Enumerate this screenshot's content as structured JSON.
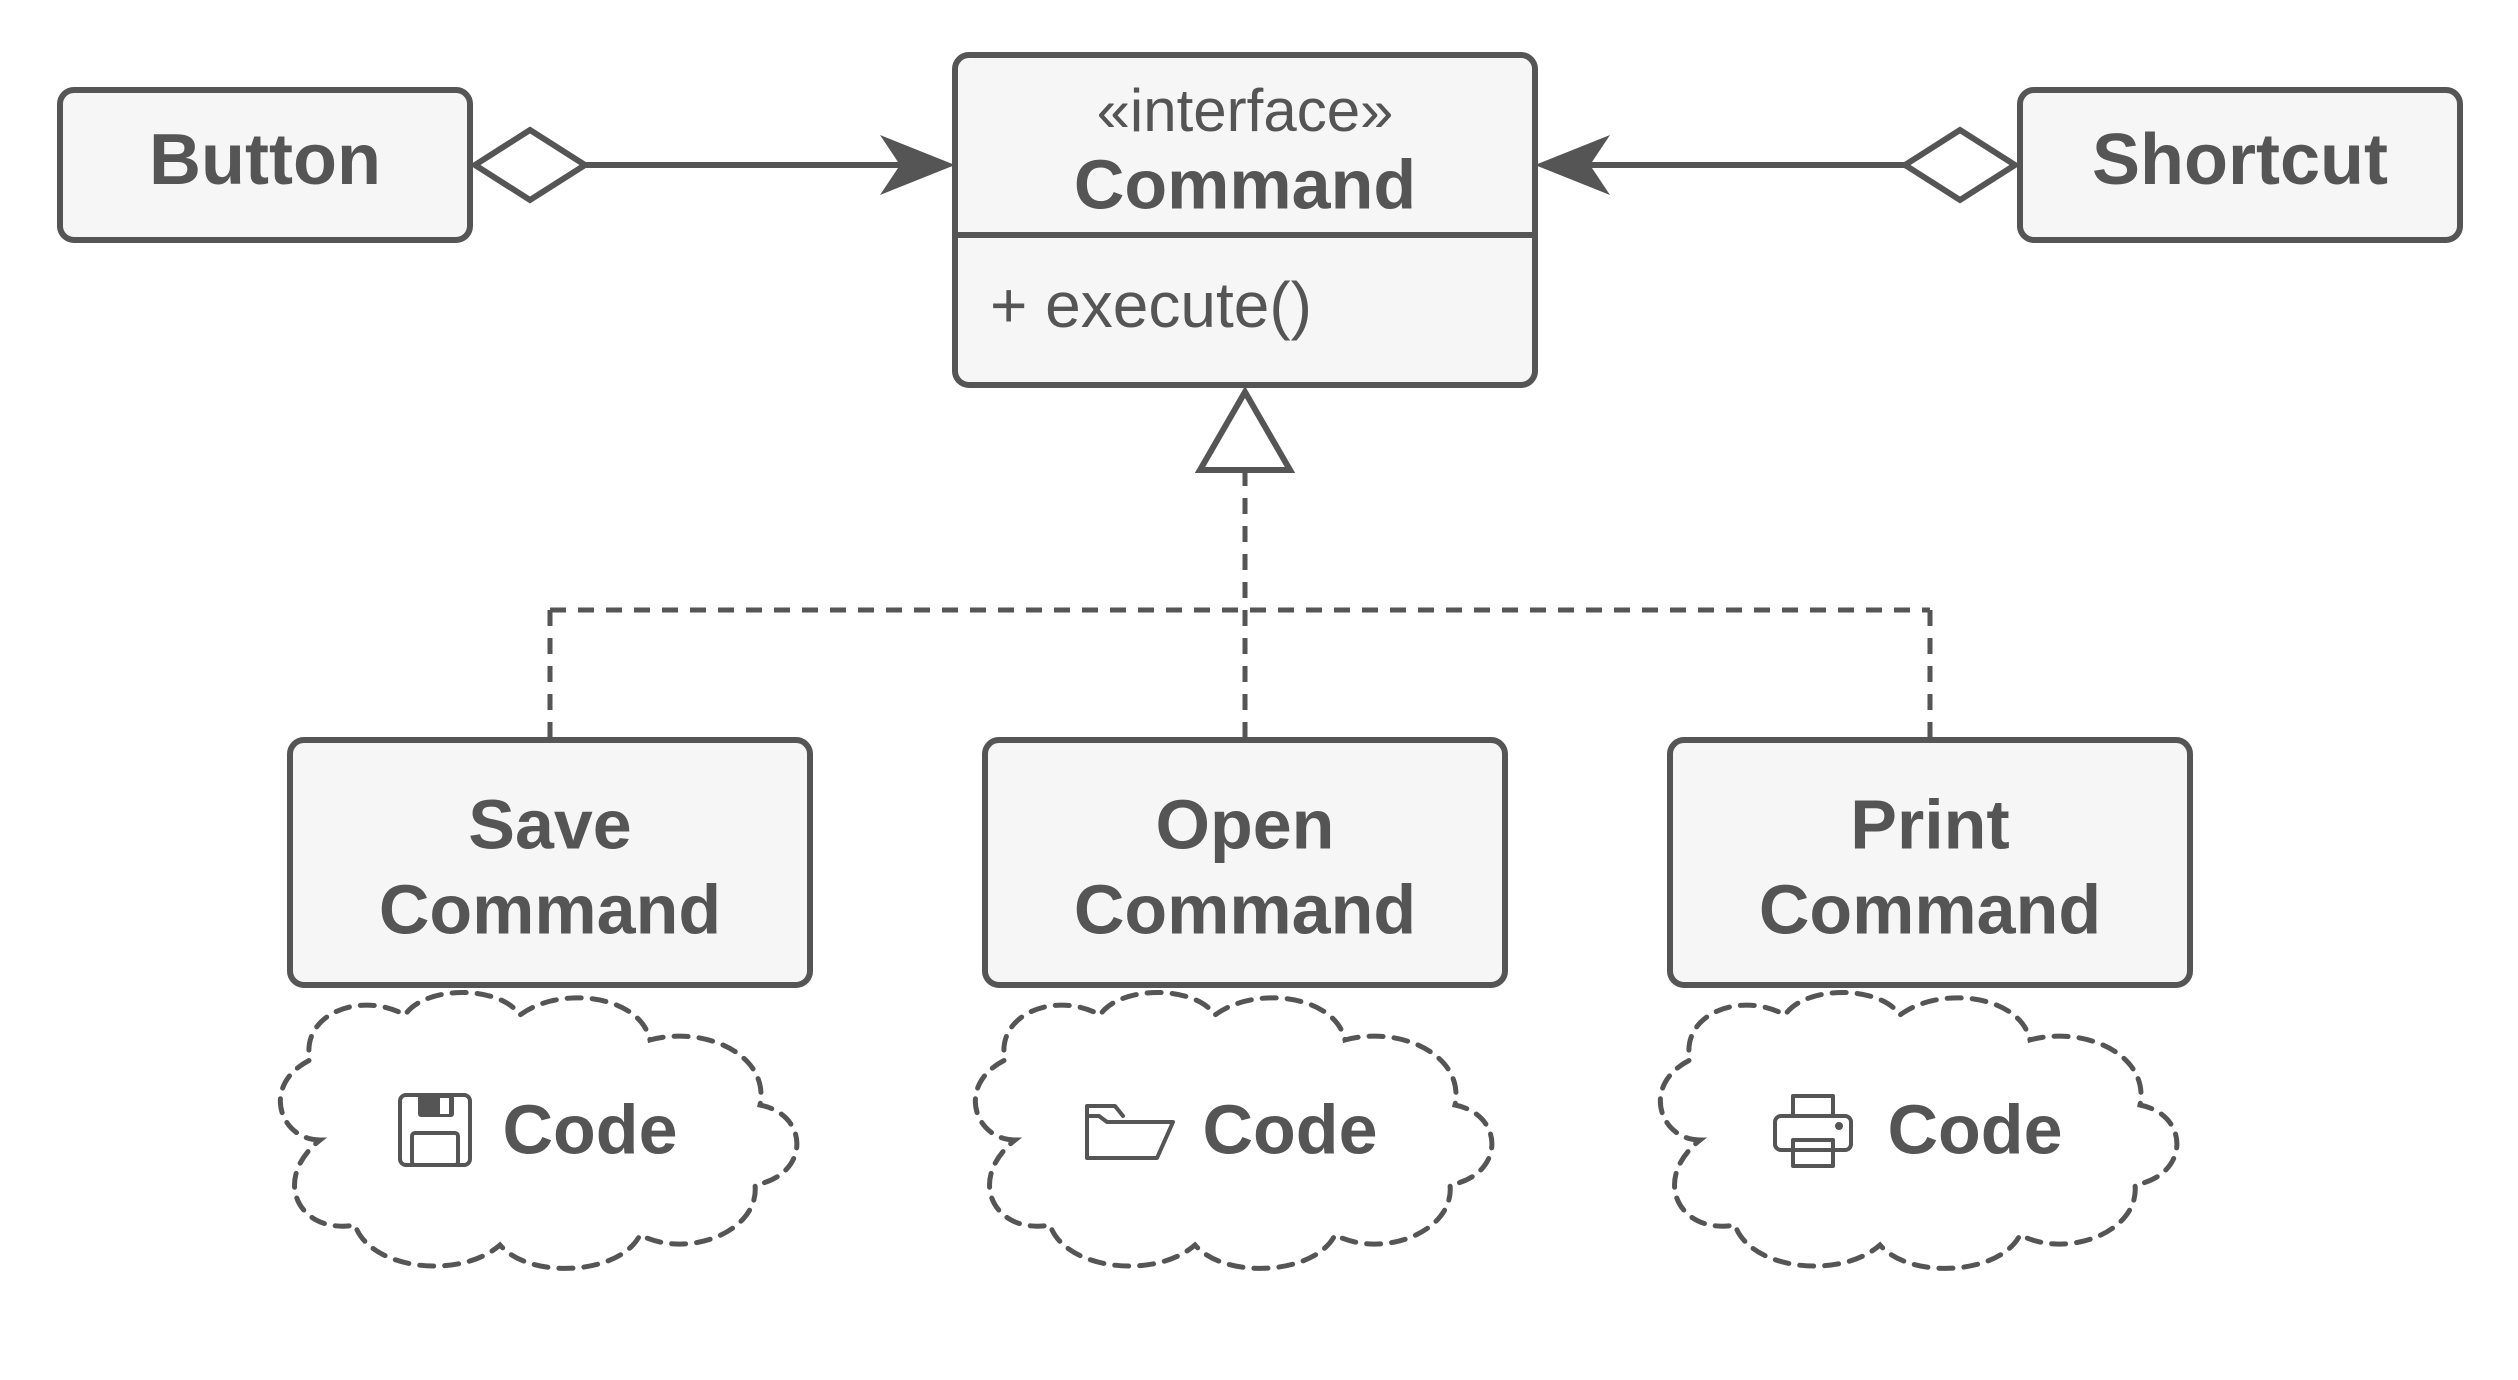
{
  "diagram": {
    "type": "uml-class",
    "interface": {
      "stereotype": "«interface»",
      "name": "Command",
      "methods": [
        "+ execute()"
      ]
    },
    "aggregators": [
      {
        "name": "Button"
      },
      {
        "name": "Shortcut"
      }
    ],
    "implementations": [
      {
        "name_line1": "Save",
        "name_line2": "Command",
        "code_label": "Code",
        "icon": "save"
      },
      {
        "name_line1": "Open",
        "name_line2": "Command",
        "code_label": "Code",
        "icon": "folder-open"
      },
      {
        "name_line1": "Print",
        "name_line2": "Command",
        "code_label": "Code",
        "icon": "print"
      }
    ]
  }
}
